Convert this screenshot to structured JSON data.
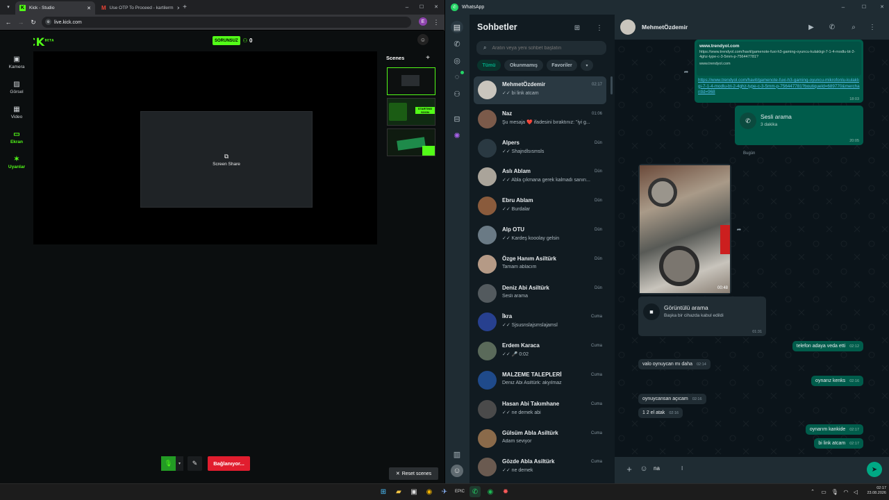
{
  "chrome": {
    "tabs": [
      {
        "title": "Kick - Studio",
        "favicon": "kick-logo"
      },
      {
        "title": "Use OTP To Proceed - kartilerm",
        "favicon": "gmail-logo"
      }
    ],
    "new_tab": "+",
    "url": "live.kick.com",
    "profile_initial": "E"
  },
  "kick": {
    "logo": "KICK",
    "logo_badge": "BETA",
    "status_badge": "SORUNSUZ",
    "viewer_count": "0",
    "nav": [
      {
        "label": "Kamera",
        "icon": "camera-icon",
        "glyph": "▣"
      },
      {
        "label": "Görsel",
        "icon": "image-icon",
        "glyph": "▨"
      },
      {
        "label": "Video",
        "icon": "video-icon",
        "glyph": "▦"
      },
      {
        "label": "Ekran",
        "icon": "screen-icon",
        "glyph": "▭"
      },
      {
        "label": "Uyarılar",
        "icon": "alerts-icon",
        "glyph": "✶"
      }
    ],
    "screen_share_label": "Screen Share",
    "scenes_title": "Scenes",
    "add_scene": "+",
    "scene_thumbs": [
      "STARTING SOON"
    ],
    "connecting_button": "Bağlanıyor...",
    "reset_scenes": "Reset scenes",
    "accent": "#53fc18"
  },
  "wa": {
    "app_title": "WhatsApp",
    "list_title": "Sohbetler",
    "search_placeholder": "Aratın veya yeni sohbet başlatın",
    "filters": [
      "Tümü",
      "Okunmamış",
      "Favoriler"
    ],
    "chats": [
      {
        "name": "MehmetÖzdemir",
        "time": "02:17",
        "preview": "✓✓ bi link atcam"
      },
      {
        "name": "Naz",
        "time": "01:06",
        "preview": "Şu mesaja ❤️ ifadesini bıraktınız: \"iyi g..."
      },
      {
        "name": "Alpers",
        "time": "Dün",
        "preview": "✓✓ Shajndlsısmsls"
      },
      {
        "name": "Aslı Ablam",
        "time": "Dün",
        "preview": "✓✓ Abla çıkmana gerek kalmadı sanırı..."
      },
      {
        "name": "Ebru Ablam",
        "time": "Dün",
        "preview": "✓✓ Burdalar"
      },
      {
        "name": "Alp OTU",
        "time": "Dün",
        "preview": "✓✓ Kardeş kooolay gelsin"
      },
      {
        "name": "Özge Hanım Asiltürk",
        "time": "Dün",
        "preview": "Tamam ablacım"
      },
      {
        "name": "Deniz Abi Asiltürk",
        "time": "Dün",
        "preview": "Sesli arama"
      },
      {
        "name": "İkra",
        "time": "Cuma",
        "preview": "✓✓ Sjsusnslajsmslajamsl"
      },
      {
        "name": "Erdem Karaca",
        "time": "Cuma",
        "preview": "✓✓ 🎤 0:02"
      },
      {
        "name": "MALZEME TALEPLERİ",
        "time": "Cuma",
        "preview": "Deniz Abi Asiltürk: akyılmaz"
      },
      {
        "name": "Hasan Abi Takımhane",
        "time": "Cuma",
        "preview": "✓✓ ne demek abi"
      },
      {
        "name": "Gülsüm Abla Asiltürk",
        "time": "Cuma",
        "preview": "Adam seviyor"
      },
      {
        "name": "Gözde Abla Asiltürk",
        "time": "Cuma",
        "preview": "✓✓ ne demek"
      }
    ],
    "contact_name": "MehmetÖzdemir",
    "link_card": {
      "site": "www.trendyol.com",
      "desc": "https://www.trendyol.com/havit/gamenote-fuxi-h3-gaming-oyuncu-kulaklıgi-7-1-4-modlu-bt-2-4ghz-type-c-3-5mm-p-756447781?",
      "domain": "www.trendyol.com",
      "link": "https://www.trendyol.com/havit/gamenote-fuxi-h3-gaming-oyuncu-mikrofonlu-kulaklıgi-7-1-4-modlu-bt-2-4ghz-type-c-3-5mm-p-756447781?boutiqueId=689770&merchantId=968",
      "time": "18:03"
    },
    "voice_call": {
      "title": "Sesli arama",
      "duration": "3 dakika",
      "time": "20:05"
    },
    "day_divider": "Bugün",
    "video_duration": "00:48",
    "video_call": {
      "title": "Görüntülü arama",
      "subtitle": "Başka bir cihazda kabul edildi",
      "time": "01:31"
    },
    "messages": [
      {
        "dir": "out",
        "text": "telefon adaya veda etti",
        "time": "02:12"
      },
      {
        "dir": "in",
        "text": "valo oynuycan mı daha",
        "time": "02:14"
      },
      {
        "dir": "out",
        "text": "oynarız kenks",
        "time": "02:16"
      },
      {
        "dir": "in",
        "text": "oynuycansan açıcam",
        "time": "02:16"
      },
      {
        "dir": "in",
        "text": "1 2 el atak",
        "time": "02:16"
      },
      {
        "dir": "out",
        "text": "oynarım kankide",
        "time": "02:17"
      },
      {
        "dir": "out",
        "text": "bi link atcam",
        "time": "02:17"
      }
    ],
    "composer_text": "na",
    "accent": "#00a884"
  },
  "taskbar": {
    "time": "02:17",
    "date": "23.08.2026"
  }
}
